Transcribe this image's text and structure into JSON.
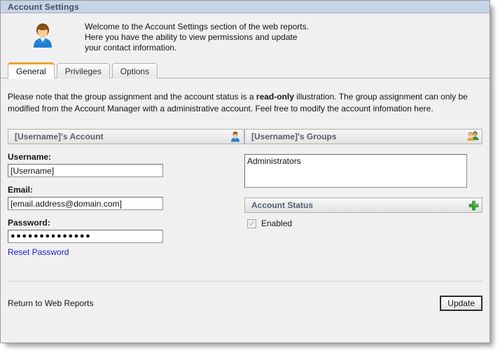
{
  "window": {
    "title": "Account Settings"
  },
  "intro": {
    "avatar_icon": "user-avatar-icon",
    "line1": "Welcome to the Account Settings section of the web reports.",
    "line2": "Here you have the ability to view permissions and update",
    "line3": "your contact information."
  },
  "tabs": [
    {
      "label": "General",
      "active": true
    },
    {
      "label": "Privileges",
      "active": false
    },
    {
      "label": "Options",
      "active": false
    }
  ],
  "note": {
    "part1": "Please note that the group assignment and the account status is a ",
    "emphasis": "read-only",
    "part2": " illustration. The group assignment can only be modified from the Account Manager with a administrative account. Feel free to modify the account infomation here."
  },
  "account_panel": {
    "header": "[Username]'s Account",
    "header_icon": "single-user-icon",
    "fields": [
      {
        "label": "Username:",
        "value": "[Username]"
      },
      {
        "label": "Email:",
        "value": "[email.address@domain.com]"
      },
      {
        "label": "Password:",
        "value": "●●●●●●●●●●●●●●"
      }
    ],
    "reset_link": "Reset Password"
  },
  "groups_panel": {
    "header": "[Username]'s Groups",
    "header_icon": "group-users-icon",
    "items": [
      "Administrators"
    ]
  },
  "status_panel": {
    "header": "Account Status",
    "header_icon": "green-plus-icon",
    "checkbox_label": "Enabled",
    "checked": true,
    "disabled": true
  },
  "footer": {
    "return_link": "Return to Web Reports",
    "update_label": "Update"
  },
  "colors": {
    "titlebar": "#c5d4e6",
    "active_tab_accent": "#f0a32a",
    "panel_header_text": "#555f6b",
    "link": "#1a1ad8",
    "background": "#f0f0f0",
    "plus_green": "#2fac2f"
  }
}
